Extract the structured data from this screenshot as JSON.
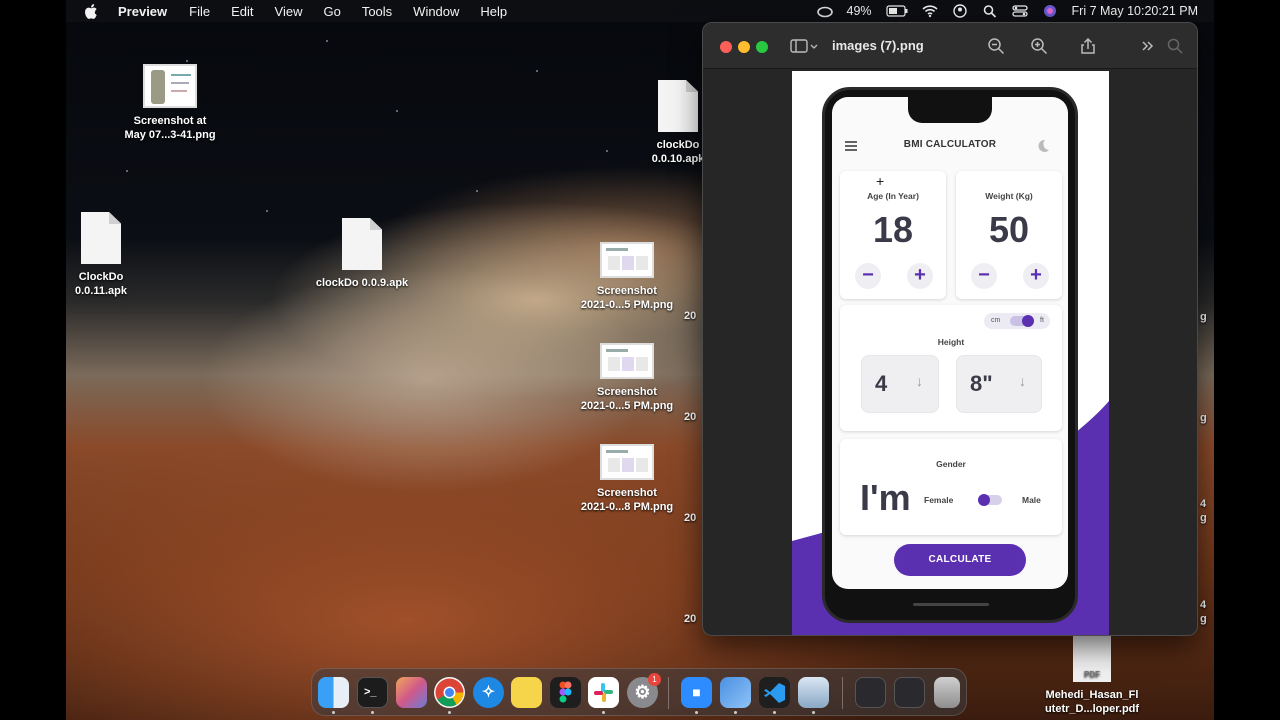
{
  "menubar": {
    "app_name": "Preview",
    "items": [
      "File",
      "Edit",
      "View",
      "Go",
      "Tools",
      "Window",
      "Help"
    ],
    "battery": "49%",
    "datetime": "Fri 7 May  10:20:21 PM"
  },
  "desktop": {
    "icons": [
      {
        "line1": "Screenshot at",
        "line2": "May 07...3-41.png"
      },
      {
        "line1": "clockDo",
        "line2": "0.0.10.apk"
      },
      {
        "line1": "ClockDo",
        "line2": "0.0.11.apk"
      },
      {
        "line1": "clockDo 0.0.9.apk",
        "line2": ""
      },
      {
        "line1": "Screenshot",
        "line2": "2021-0...5 PM.png"
      },
      {
        "line1": "Screenshot",
        "line2": "2021-0...5 PM.png"
      },
      {
        "line1": "Screenshot",
        "line2": "2021-0...8 PM.png"
      },
      {
        "line1": "Mehedi_Hasan_Fl",
        "line2": "utetr_D...loper.pdf"
      }
    ],
    "partial_labels": [
      "20",
      "20",
      "20",
      "20",
      "g",
      "g",
      "4",
      "g",
      "4",
      "g"
    ],
    "pdf_tag": "PDF"
  },
  "preview_window": {
    "title": "images (7).png"
  },
  "bmi_app": {
    "title": "BMI CALCULATOR",
    "age": {
      "label": "Age (In Year)",
      "value": "18",
      "minus": "−",
      "plus": "+"
    },
    "weight": {
      "label": "Weight (Kg)",
      "value": "50",
      "minus": "−",
      "plus": "+"
    },
    "height": {
      "label": "Height",
      "unit_left": "cm",
      "unit_right": "ft",
      "feet": "4",
      "inches": "8\"",
      "arrow": "↓"
    },
    "gender": {
      "label": "Gender",
      "prefix": "I'm",
      "female": "Female",
      "male": "Male"
    },
    "calculate": "CALCULATE"
  },
  "dock": {
    "badge_count": "1"
  },
  "colors": {
    "accent": "#5a2fb0",
    "close": "#ff5f57",
    "minimize": "#febc2e",
    "zoom": "#28c840"
  }
}
